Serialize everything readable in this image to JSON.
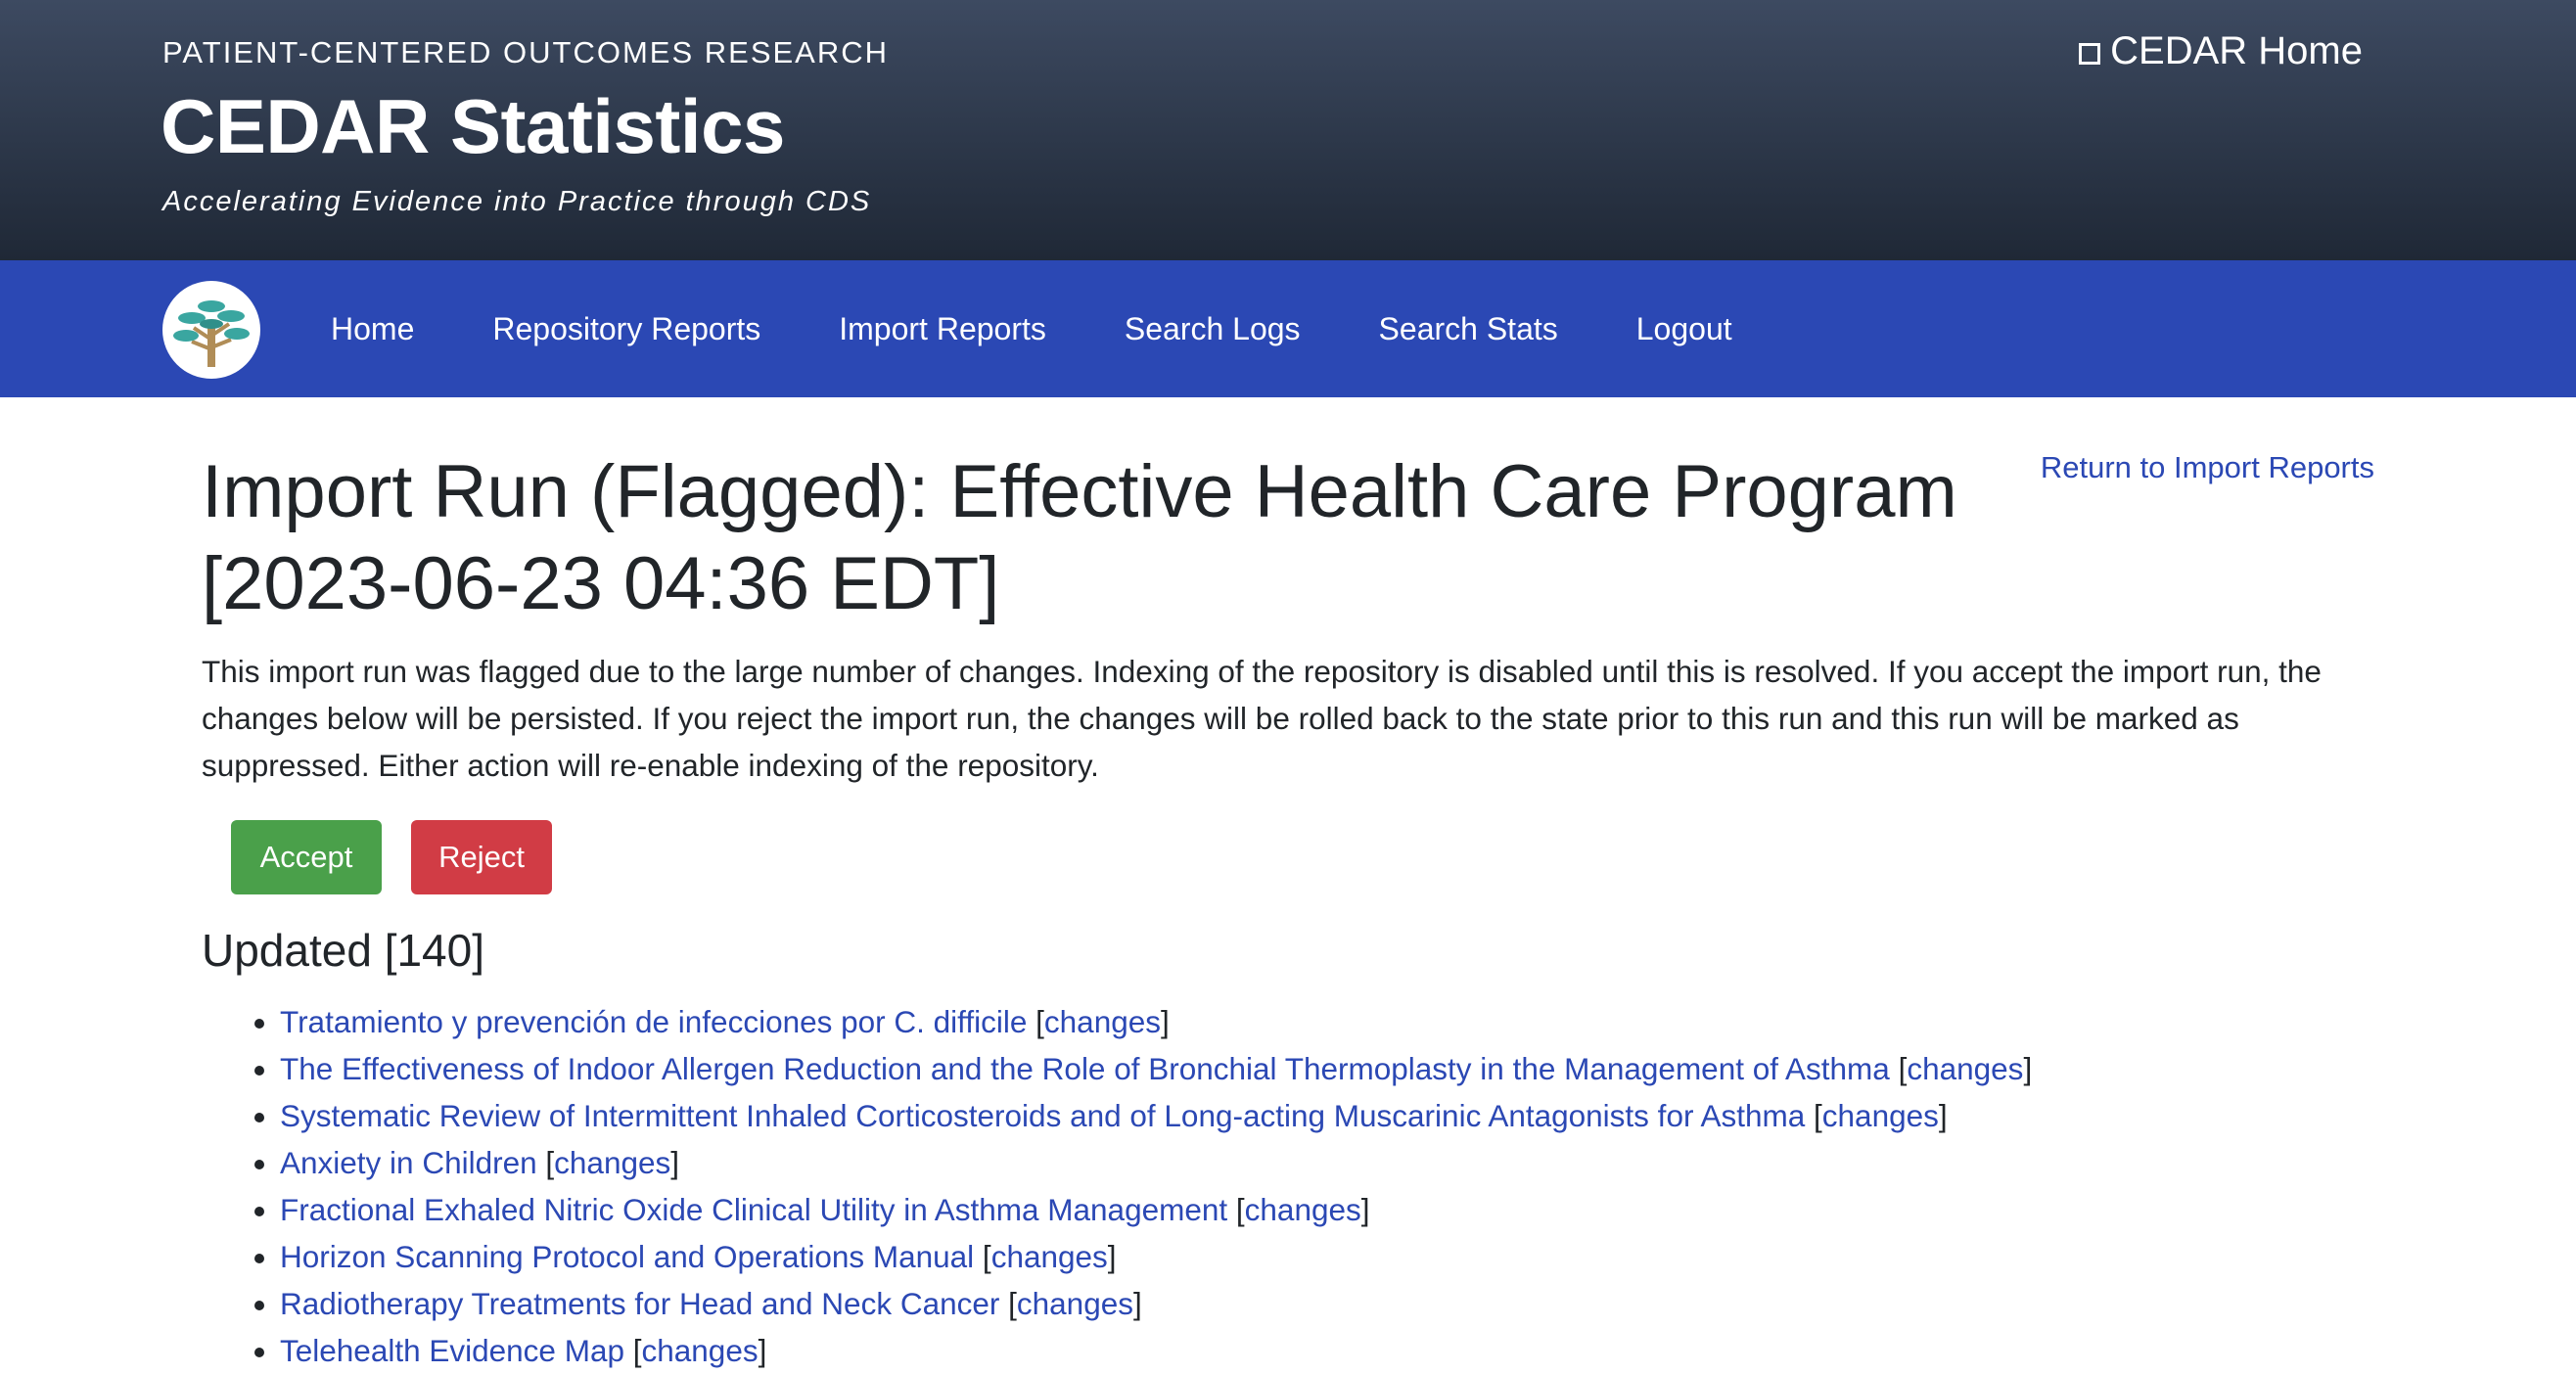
{
  "header": {
    "kicker": "PATIENT-CENTERED OUTCOMES RESEARCH",
    "title": "CEDAR Statistics",
    "tagline": "Accelerating Evidence into Practice through CDS",
    "home_link": "CEDAR Home"
  },
  "nav": {
    "items": [
      "Home",
      "Repository Reports",
      "Import Reports",
      "Search Logs",
      "Search Stats",
      "Logout"
    ]
  },
  "main": {
    "return_link": "Return to Import Reports",
    "title": "Import Run (Flagged): Effective Health Care Program [2023-06-23 04:36 EDT]",
    "intro": "This import run was flagged due to the large number of changes. Indexing of the repository is disabled until this is resolved. If you accept the import run, the changes below will be persisted. If you reject the import run, the changes will be rolled back to the state prior to this run and this run will be marked as suppressed. Either action will re-enable indexing of the repository.",
    "accept_label": "Accept",
    "reject_label": "Reject",
    "section_heading": "Updated [140]",
    "changes_label": "changes",
    "updated_items": [
      "Tratamiento y prevención de infecciones por C. difficile",
      "The Effectiveness of Indoor Allergen Reduction and the Role of Bronchial Thermoplasty in the Management of Asthma",
      "Systematic Review of Intermittent Inhaled Corticosteroids and of Long-acting Muscarinic Antagonists for Asthma",
      "Anxiety in Children",
      "Fractional Exhaled Nitric Oxide Clinical Utility in Asthma Management",
      "Horizon Scanning Protocol and Operations Manual",
      "Radiotherapy Treatments for Head and Neck Cancer",
      "Telehealth Evidence Map"
    ]
  },
  "colors": {
    "header_top": "#3d4a61",
    "header_bottom": "#1f2836",
    "nav_bg": "#2b48b4",
    "link": "#2b48b4",
    "accept": "#4aa04a",
    "reject": "#d13c45"
  }
}
